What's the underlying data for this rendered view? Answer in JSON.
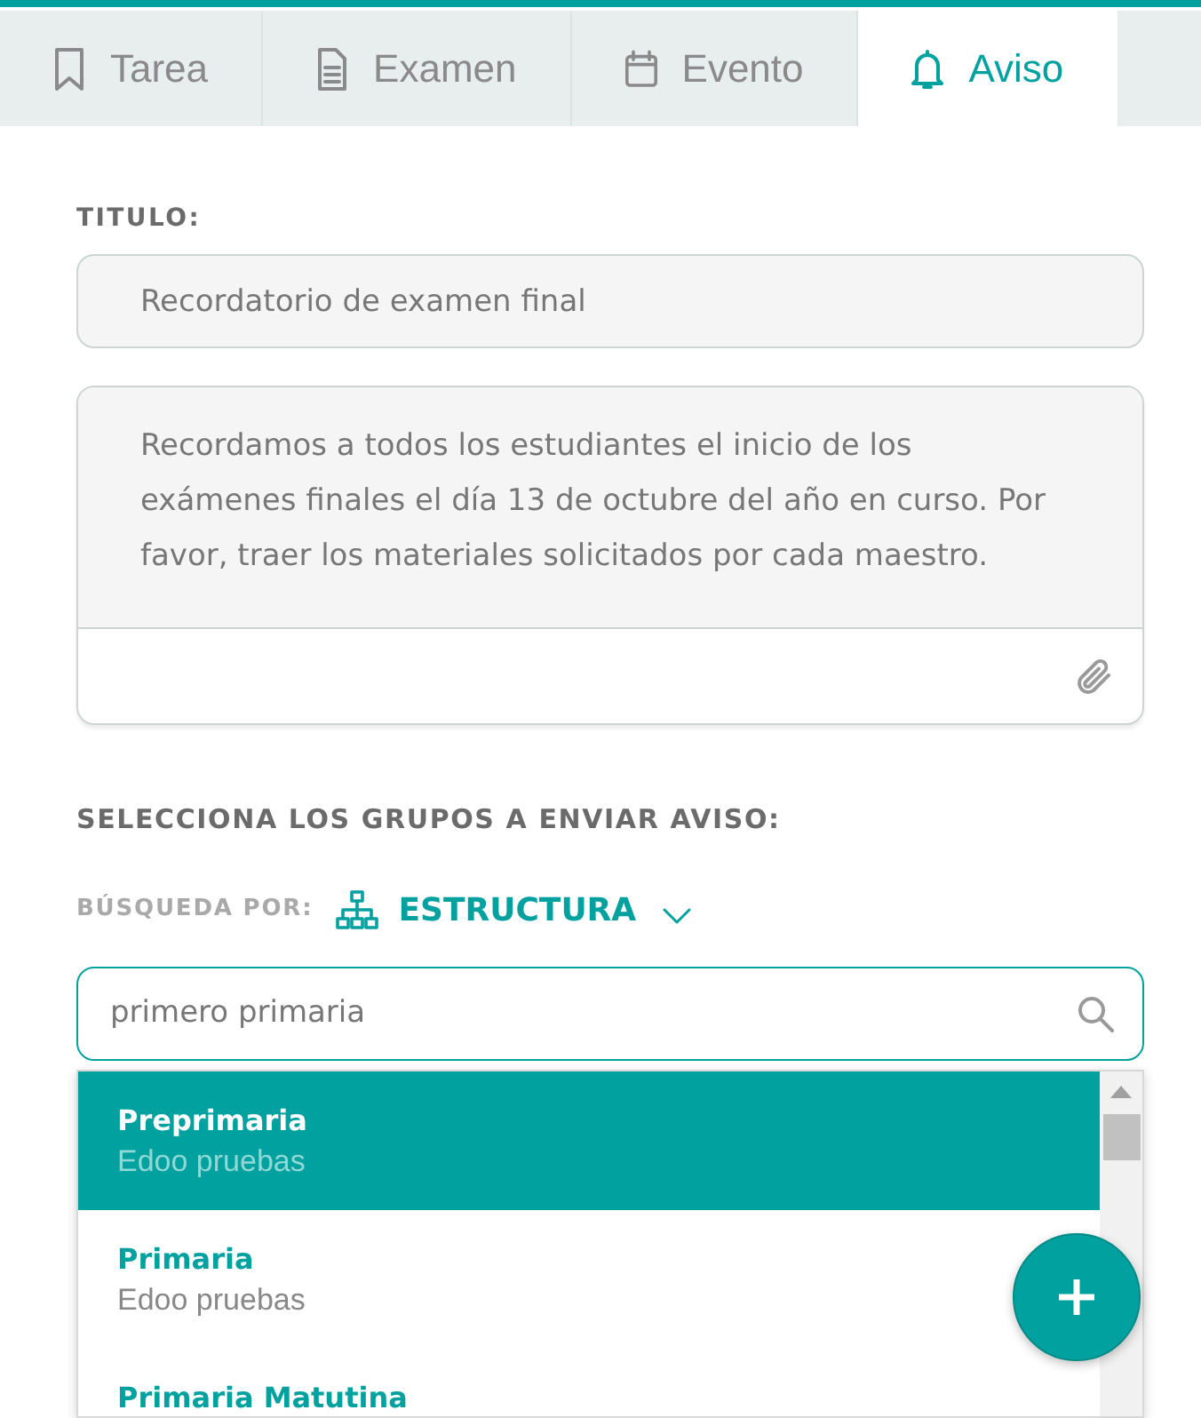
{
  "tabs": [
    {
      "label": "Tarea",
      "selected": false
    },
    {
      "label": "Examen",
      "selected": false
    },
    {
      "label": "Evento",
      "selected": false
    },
    {
      "label": "Aviso",
      "selected": true
    }
  ],
  "title_field": {
    "label": "TITULO:",
    "value": "Recordatorio de examen final"
  },
  "message_field": {
    "value": "Recordamos a todos los estudiantes el inicio de los exámenes finales el día 13 de octubre del año en curso. Por favor, traer los materiales solicitados por cada maestro."
  },
  "groups": {
    "heading": "SELECCIONA LOS GRUPOS A ENVIAR AVISO:",
    "search_by_label": "BÚSQUEDA POR:",
    "search_by_value": "ESTRUCTURA",
    "search": {
      "value": "primero primaria"
    },
    "results": [
      {
        "name": "Preprimaria",
        "school": "Edoo pruebas",
        "selected": true
      },
      {
        "name": "Primaria",
        "school": "Edoo pruebas",
        "selected": false
      },
      {
        "name": "Primaria Matutina",
        "selected": false
      }
    ]
  }
}
